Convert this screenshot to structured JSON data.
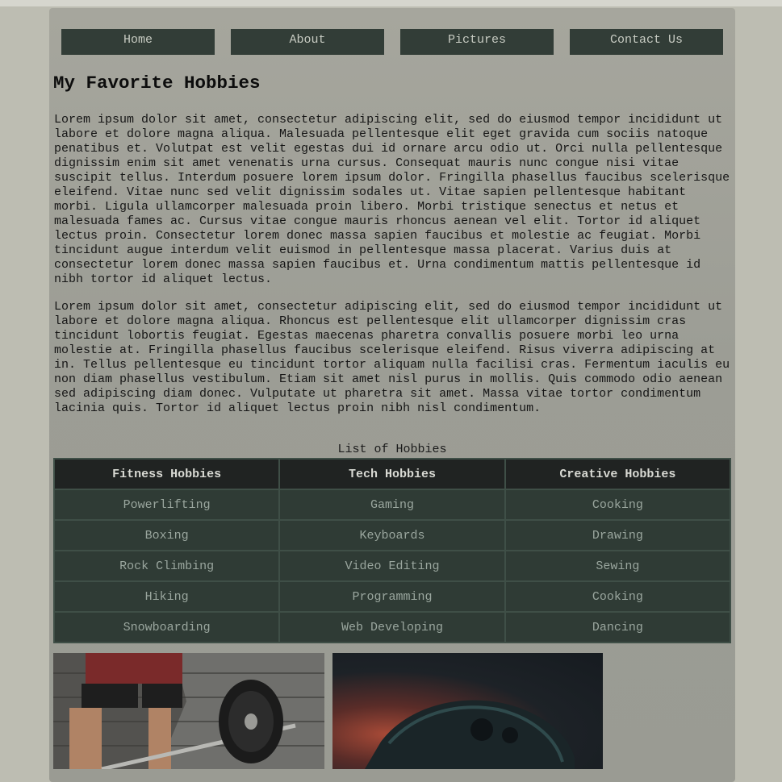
{
  "nav": {
    "items": [
      "Home",
      "About",
      "Pictures",
      "Contact Us"
    ]
  },
  "page_title": "My Favorite Hobbies",
  "paragraphs": [
    "Lorem ipsum dolor sit amet, consectetur adipiscing elit, sed do eiusmod tempor incididunt ut labore et dolore magna aliqua. Malesuada pellentesque elit eget gravida cum sociis natoque penatibus et. Volutpat est velit egestas dui id ornare arcu odio ut. Orci nulla pellentesque dignissim enim sit amet venenatis urna cursus. Consequat mauris nunc congue nisi vitae suscipit tellus. Interdum posuere lorem ipsum dolor. Fringilla phasellus faucibus scelerisque eleifend. Vitae nunc sed velit dignissim sodales ut. Vitae sapien pellentesque habitant morbi. Ligula ullamcorper malesuada proin libero. Morbi tristique senectus et netus et malesuada fames ac. Cursus vitae congue mauris rhoncus aenean vel elit. Tortor id aliquet lectus proin. Consectetur lorem donec massa sapien faucibus et molestie ac feugiat. Morbi tincidunt augue interdum velit euismod in pellentesque massa placerat. Varius duis at consectetur lorem donec massa sapien faucibus et. Urna condimentum mattis pellentesque id nibh tortor id aliquet lectus.",
    "Lorem ipsum dolor sit amet, consectetur adipiscing elit, sed do eiusmod tempor incididunt ut labore et dolore magna aliqua. Rhoncus est pellentesque elit ullamcorper dignissim cras tincidunt lobortis feugiat. Egestas maecenas pharetra convallis posuere morbi leo urna molestie at. Fringilla phasellus faucibus scelerisque eleifend. Risus viverra adipiscing at in. Tellus pellentesque eu tincidunt tortor aliquam nulla facilisi cras. Fermentum iaculis eu non diam phasellus vestibulum. Etiam sit amet nisl purus in mollis. Quis commodo odio aenean sed adipiscing diam donec. Vulputate ut pharetra sit amet. Massa vitae tortor condimentum lacinia quis. Tortor id aliquet lectus proin nibh nisl condimentum."
  ],
  "table": {
    "caption": "List of Hobbies",
    "headers": [
      "Fitness Hobbies",
      "Tech Hobbies",
      "Creative Hobbies"
    ],
    "rows": [
      [
        "Powerlifting",
        "Gaming",
        "Cooking"
      ],
      [
        "Boxing",
        "Keyboards",
        "Drawing"
      ],
      [
        "Rock Climbing",
        "Video Editing",
        "Sewing"
      ],
      [
        "Hiking",
        "Programming",
        "Cooking"
      ],
      [
        "Snowboarding",
        "Web Developing",
        "Dancing"
      ]
    ]
  },
  "colors": {
    "nav_bg": "#323d37",
    "table_header_bg": "#202322",
    "table_cell_bg": "#2f3b35"
  }
}
